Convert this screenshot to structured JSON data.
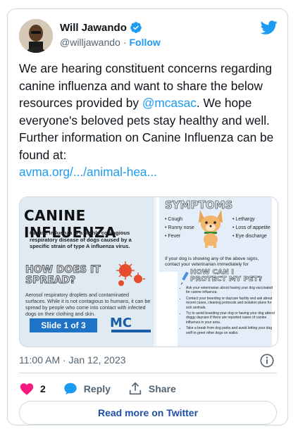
{
  "author": {
    "name": "Will Jawando",
    "handle": "@willjawando",
    "separator": "·",
    "follow_label": "Follow"
  },
  "tweet": {
    "text_part1": "We are hearing constituent concerns regarding canine influenza and want to share the below resources provided by ",
    "mention": "@mcasac",
    "text_part2": ". We hope everyone's beloved pets stay healthy and well. Further information on Canine Influenza can be found at:",
    "link": "avma.org/.../animal-hea..."
  },
  "media": {
    "title": "CANINE INFLUENZA",
    "description": "Canine influenza is a highly contagious respiratory disease of dogs caused by a specific strain of type A influenza virus.",
    "spread_question": "HOW DOES IT SPREAD?",
    "spread_text": "Aerosol respiratory droplets and contaminated surfaces. While it is not contagious to humans, it can be spread by people who come into contact with infected dogs on their clothing and skin.",
    "slide_label": "Slide 1 of 3",
    "logo_text": "MC",
    "symptoms_title": "SYMPTOMS",
    "symptoms_left": [
      "Cough",
      "Runny nose",
      "Fever"
    ],
    "symptoms_right": [
      "Lethargy",
      "Loss of appetite",
      "Eye discharge"
    ],
    "symptoms_note": "If your dog is showing any of the above signs, contact your veterinarian immediately for",
    "protect_title": "HOW CAN I PROTECT MY PET?",
    "protect_items": [
      "Ask your veterinarian about having your dog vaccinated for canine influenza.",
      "Contact your boarding or daycare facility and ask about recent cases, cleaning protocols and isolation plans for sick animals.",
      "Try to avoid boarding your dog or having your dog attend doggy daycare if there are reported cases of canine influenza in your area.",
      "Take a break from dog parks and avoid letting your dog sniff to greet other dogs on walks."
    ]
  },
  "timestamp": "11:00 AM · Jan 12, 2023",
  "actions": {
    "like_count": "2",
    "reply_label": "Reply",
    "share_label": "Share"
  },
  "read_more_label": "Read more on Twitter",
  "colors": {
    "accent": "#1d9bf0",
    "like": "#f91880",
    "read_more_text": "#1d4fa3"
  }
}
